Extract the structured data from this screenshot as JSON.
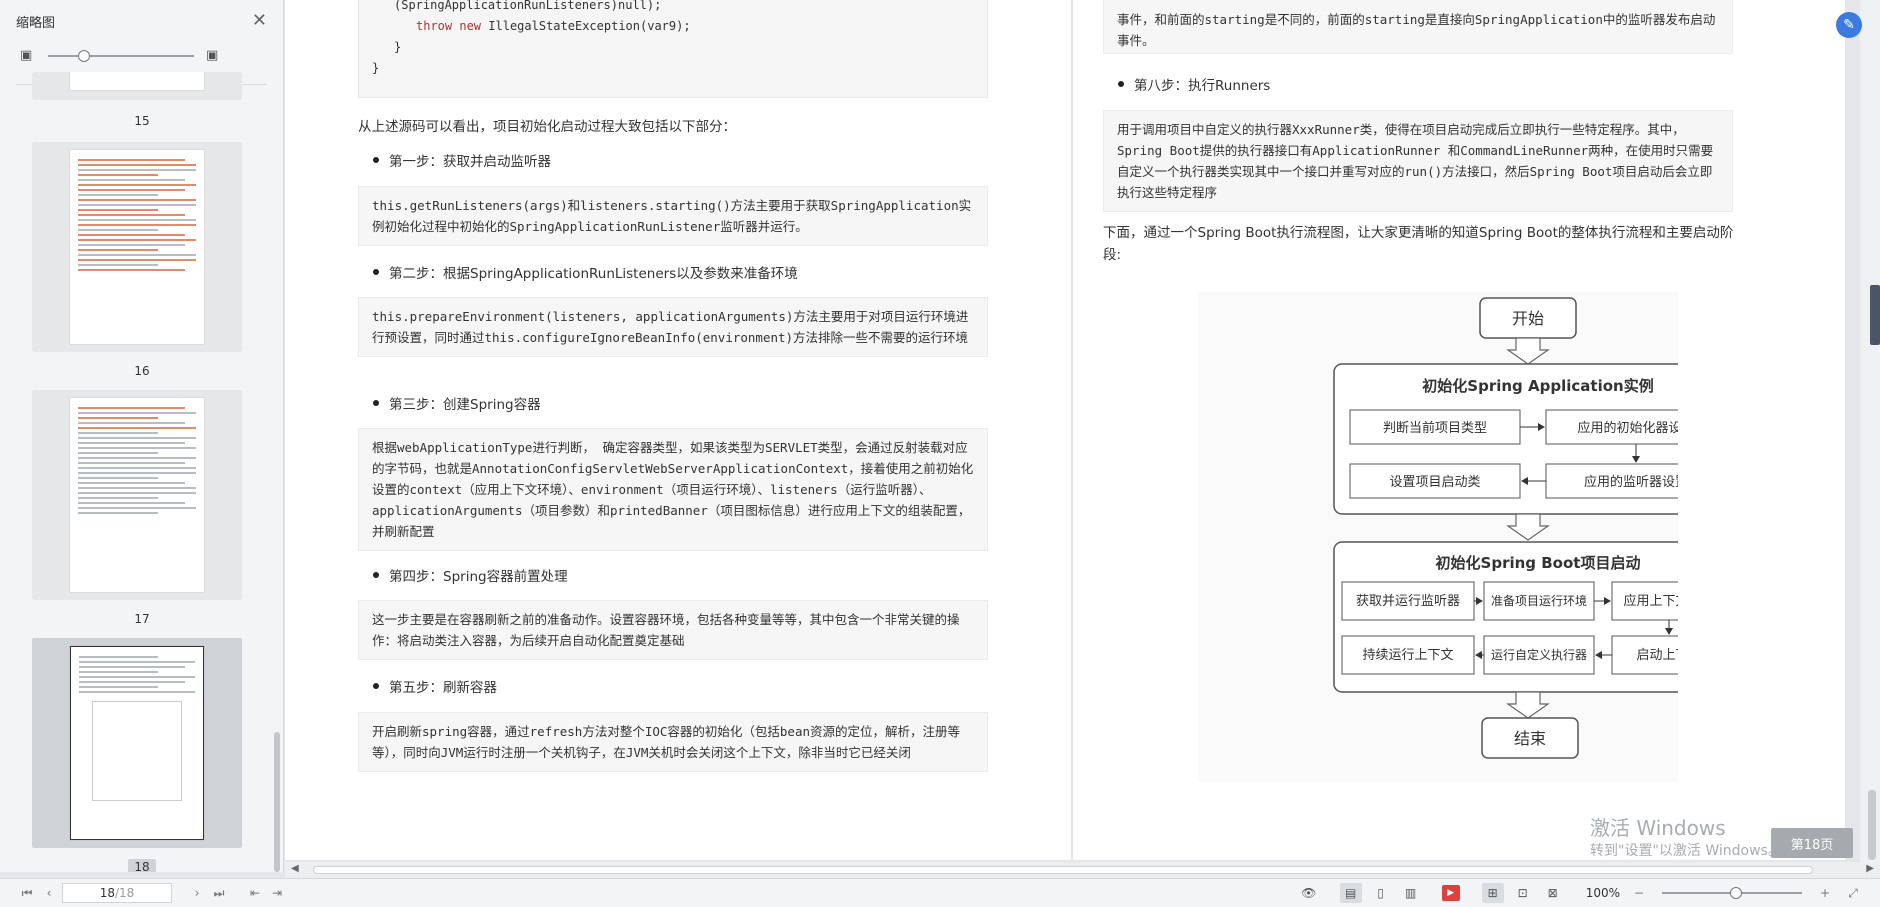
{
  "sidebar": {
    "title": "缩略图",
    "thumbnails": [
      {
        "number": "15"
      },
      {
        "number": "16"
      },
      {
        "number": "17"
      },
      {
        "number": "18"
      }
    ]
  },
  "left_page": {
    "code_lines": [
      "(SpringApplicationRunListeners)null);",
      "throw new IllegalStateException(var9);",
      "}",
      "}"
    ],
    "code_kw_throw": "throw",
    "code_kw_new": "new",
    "intro": "从上述源码可以看出，项目初始化启动过程大致包括以下部分：",
    "steps": [
      {
        "title": "第一步：获取并启动监听器",
        "body": "this.getRunListeners(args)和listeners.starting()方法主要用于获取SpringApplication实例初始化过程中初始化的SpringApplicationRunListener监听器并运行。"
      },
      {
        "title": "第二步：根据SpringApplicationRunListeners以及参数来准备环境",
        "body": "this.prepareEnvironment(listeners, applicationArguments)方法主要用于对项目运行环境进行预设置，同时通过this.configureIgnoreBeanInfo(environment)方法排除一些不需要的运行环境"
      },
      {
        "title": "第三步：创建Spring容器",
        "body": "根据webApplicationType进行判断， 确定容器类型，如果该类型为SERVLET类型，会通过反射装载对应的字节码，也就是AnnotationConfigServletWebServerApplicationContext，接着使用之前初始化设置的context（应用上下文环境）、environment（项目运行环境）、listeners（运行监听器）、applicationArguments（项目参数）和printedBanner（项目图标信息）进行应用上下文的组装配置，并刷新配置"
      },
      {
        "title": "第四步：Spring容器前置处理",
        "body": "这一步主要是在容器刷新之前的准备动作。设置容器环境，包括各种变量等等，其中包含一个非常关键的操作：将启动类注入容器，为后续开启自动化配置奠定基础"
      },
      {
        "title": "第五步：刷新容器",
        "body": "开启刷新spring容器，通过refresh方法对整个IOC容器的初始化（包括bean资源的定位，解析，注册等等），同时向JVM运行时注册一个关机钩子，在JVM关机时会关闭这个上下文，除非当时它已经关闭"
      }
    ]
  },
  "right_page": {
    "top_box": "事件，和前面的starting是不同的，前面的starting是直接向SpringApplication中的监听器发布启动事件。",
    "step8_title": "第八步：执行Runners",
    "step8_body": "用于调用项目中自定义的执行器XxxRunner类，使得在项目启动完成后立即执行一些特定程序。其中，Spring Boot提供的执行器接口有ApplicationRunner 和CommandLineRunner两种，在使用时只需要自定义一个执行器类实现其中一个接口并重写对应的run()方法接口，然后Spring Boot项目启动后会立即执行这些特定程序",
    "flow_intro": "下面，通过一个Spring Boot执行流程图，让大家更清晰的知道Spring Boot的整体执行流程和主要启动阶段:"
  },
  "flowchart": {
    "start": "开始",
    "end": "结束",
    "group1": {
      "title": "初始化Spring Application实例",
      "boxes": [
        "判断当前项目类型",
        "应用的初始化器设置",
        "设置项目启动类",
        "应用的监听器设置"
      ]
    },
    "group2": {
      "title": "初始化Spring Boot项目启动",
      "boxes": [
        "获取并运行监听器",
        "准备项目运行环境",
        "应用上下文装配",
        "持续运行上下文",
        "运行自定义执行器",
        "启动上下文"
      ]
    }
  },
  "watermark": {
    "line1": "激活 Windows",
    "line2": "转到\"设置\"以激活 Windows。"
  },
  "page_badge": "第18页",
  "statusbar": {
    "current_page": "18",
    "total_pages": "/18",
    "zoom": "100%"
  },
  "colors": {
    "accent": "#3a7be0",
    "play": "#e0403c",
    "code_keyword": "#aa3333"
  }
}
